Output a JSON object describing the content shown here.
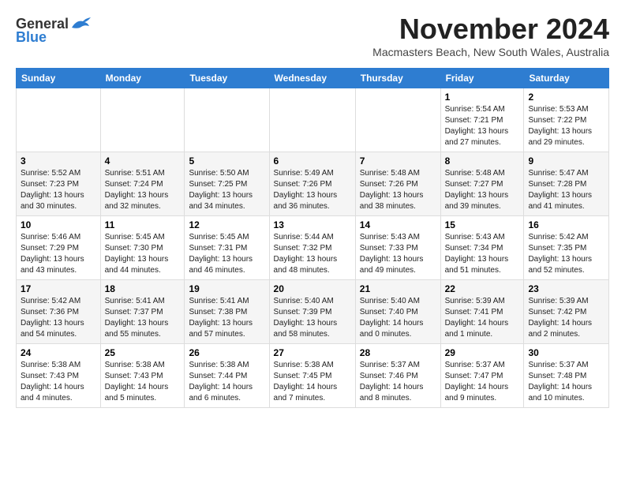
{
  "logo": {
    "general": "General",
    "blue": "Blue"
  },
  "title": "November 2024",
  "subtitle": "Macmasters Beach, New South Wales, Australia",
  "days_of_week": [
    "Sunday",
    "Monday",
    "Tuesday",
    "Wednesday",
    "Thursday",
    "Friday",
    "Saturday"
  ],
  "weeks": [
    [
      {
        "day": "",
        "info": ""
      },
      {
        "day": "",
        "info": ""
      },
      {
        "day": "",
        "info": ""
      },
      {
        "day": "",
        "info": ""
      },
      {
        "day": "",
        "info": ""
      },
      {
        "day": "1",
        "info": "Sunrise: 5:54 AM\nSunset: 7:21 PM\nDaylight: 13 hours\nand 27 minutes."
      },
      {
        "day": "2",
        "info": "Sunrise: 5:53 AM\nSunset: 7:22 PM\nDaylight: 13 hours\nand 29 minutes."
      }
    ],
    [
      {
        "day": "3",
        "info": "Sunrise: 5:52 AM\nSunset: 7:23 PM\nDaylight: 13 hours\nand 30 minutes."
      },
      {
        "day": "4",
        "info": "Sunrise: 5:51 AM\nSunset: 7:24 PM\nDaylight: 13 hours\nand 32 minutes."
      },
      {
        "day": "5",
        "info": "Sunrise: 5:50 AM\nSunset: 7:25 PM\nDaylight: 13 hours\nand 34 minutes."
      },
      {
        "day": "6",
        "info": "Sunrise: 5:49 AM\nSunset: 7:26 PM\nDaylight: 13 hours\nand 36 minutes."
      },
      {
        "day": "7",
        "info": "Sunrise: 5:48 AM\nSunset: 7:26 PM\nDaylight: 13 hours\nand 38 minutes."
      },
      {
        "day": "8",
        "info": "Sunrise: 5:48 AM\nSunset: 7:27 PM\nDaylight: 13 hours\nand 39 minutes."
      },
      {
        "day": "9",
        "info": "Sunrise: 5:47 AM\nSunset: 7:28 PM\nDaylight: 13 hours\nand 41 minutes."
      }
    ],
    [
      {
        "day": "10",
        "info": "Sunrise: 5:46 AM\nSunset: 7:29 PM\nDaylight: 13 hours\nand 43 minutes."
      },
      {
        "day": "11",
        "info": "Sunrise: 5:45 AM\nSunset: 7:30 PM\nDaylight: 13 hours\nand 44 minutes."
      },
      {
        "day": "12",
        "info": "Sunrise: 5:45 AM\nSunset: 7:31 PM\nDaylight: 13 hours\nand 46 minutes."
      },
      {
        "day": "13",
        "info": "Sunrise: 5:44 AM\nSunset: 7:32 PM\nDaylight: 13 hours\nand 48 minutes."
      },
      {
        "day": "14",
        "info": "Sunrise: 5:43 AM\nSunset: 7:33 PM\nDaylight: 13 hours\nand 49 minutes."
      },
      {
        "day": "15",
        "info": "Sunrise: 5:43 AM\nSunset: 7:34 PM\nDaylight: 13 hours\nand 51 minutes."
      },
      {
        "day": "16",
        "info": "Sunrise: 5:42 AM\nSunset: 7:35 PM\nDaylight: 13 hours\nand 52 minutes."
      }
    ],
    [
      {
        "day": "17",
        "info": "Sunrise: 5:42 AM\nSunset: 7:36 PM\nDaylight: 13 hours\nand 54 minutes."
      },
      {
        "day": "18",
        "info": "Sunrise: 5:41 AM\nSunset: 7:37 PM\nDaylight: 13 hours\nand 55 minutes."
      },
      {
        "day": "19",
        "info": "Sunrise: 5:41 AM\nSunset: 7:38 PM\nDaylight: 13 hours\nand 57 minutes."
      },
      {
        "day": "20",
        "info": "Sunrise: 5:40 AM\nSunset: 7:39 PM\nDaylight: 13 hours\nand 58 minutes."
      },
      {
        "day": "21",
        "info": "Sunrise: 5:40 AM\nSunset: 7:40 PM\nDaylight: 14 hours\nand 0 minutes."
      },
      {
        "day": "22",
        "info": "Sunrise: 5:39 AM\nSunset: 7:41 PM\nDaylight: 14 hours\nand 1 minute."
      },
      {
        "day": "23",
        "info": "Sunrise: 5:39 AM\nSunset: 7:42 PM\nDaylight: 14 hours\nand 2 minutes."
      }
    ],
    [
      {
        "day": "24",
        "info": "Sunrise: 5:38 AM\nSunset: 7:43 PM\nDaylight: 14 hours\nand 4 minutes."
      },
      {
        "day": "25",
        "info": "Sunrise: 5:38 AM\nSunset: 7:43 PM\nDaylight: 14 hours\nand 5 minutes."
      },
      {
        "day": "26",
        "info": "Sunrise: 5:38 AM\nSunset: 7:44 PM\nDaylight: 14 hours\nand 6 minutes."
      },
      {
        "day": "27",
        "info": "Sunrise: 5:38 AM\nSunset: 7:45 PM\nDaylight: 14 hours\nand 7 minutes."
      },
      {
        "day": "28",
        "info": "Sunrise: 5:37 AM\nSunset: 7:46 PM\nDaylight: 14 hours\nand 8 minutes."
      },
      {
        "day": "29",
        "info": "Sunrise: 5:37 AM\nSunset: 7:47 PM\nDaylight: 14 hours\nand 9 minutes."
      },
      {
        "day": "30",
        "info": "Sunrise: 5:37 AM\nSunset: 7:48 PM\nDaylight: 14 hours\nand 10 minutes."
      }
    ]
  ]
}
